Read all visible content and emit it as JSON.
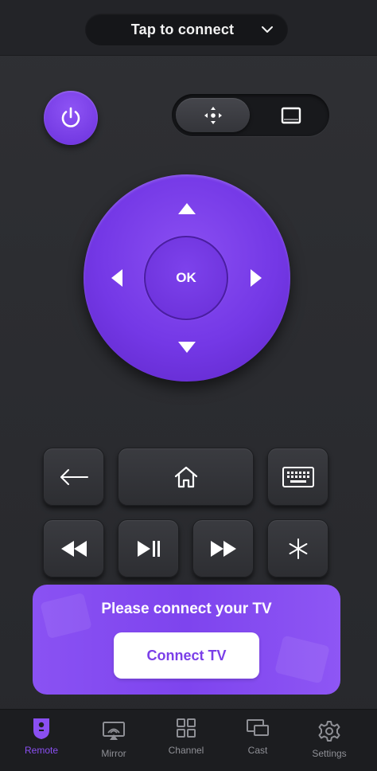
{
  "header": {
    "connect_label": "Tap to connect",
    "chevron_icon": "chevron-down-icon"
  },
  "remote": {
    "power_icon": "power-icon",
    "mode_toggle": {
      "dpad_icon": "dpad-mode-icon",
      "touchpad_icon": "touchpad-mode-icon",
      "active": "dpad"
    },
    "dpad": {
      "ok_label": "OK"
    },
    "keys": {
      "back_icon": "arrow-left-icon",
      "home_icon": "home-icon",
      "keyboard_icon": "keyboard-icon",
      "rewind_icon": "rewind-icon",
      "play_pause_icon": "play-pause-icon",
      "fast_forward_icon": "fast-forward-icon",
      "options_icon": "asterisk-icon"
    }
  },
  "banner": {
    "title": "Please connect your TV",
    "button_label": "Connect TV"
  },
  "bottom_nav": {
    "items": [
      {
        "label": "Remote",
        "icon": "remote-icon",
        "active": true
      },
      {
        "label": "Mirror",
        "icon": "mirror-icon",
        "active": false
      },
      {
        "label": "Channel",
        "icon": "grid-icon",
        "active": false
      },
      {
        "label": "Cast",
        "icon": "cast-icon",
        "active": false
      },
      {
        "label": "Settings",
        "icon": "gear-icon",
        "active": false
      }
    ]
  },
  "colors": {
    "accent": "#7b3fe8",
    "background": "#2b2c30",
    "nav_inactive": "#8f9096"
  }
}
